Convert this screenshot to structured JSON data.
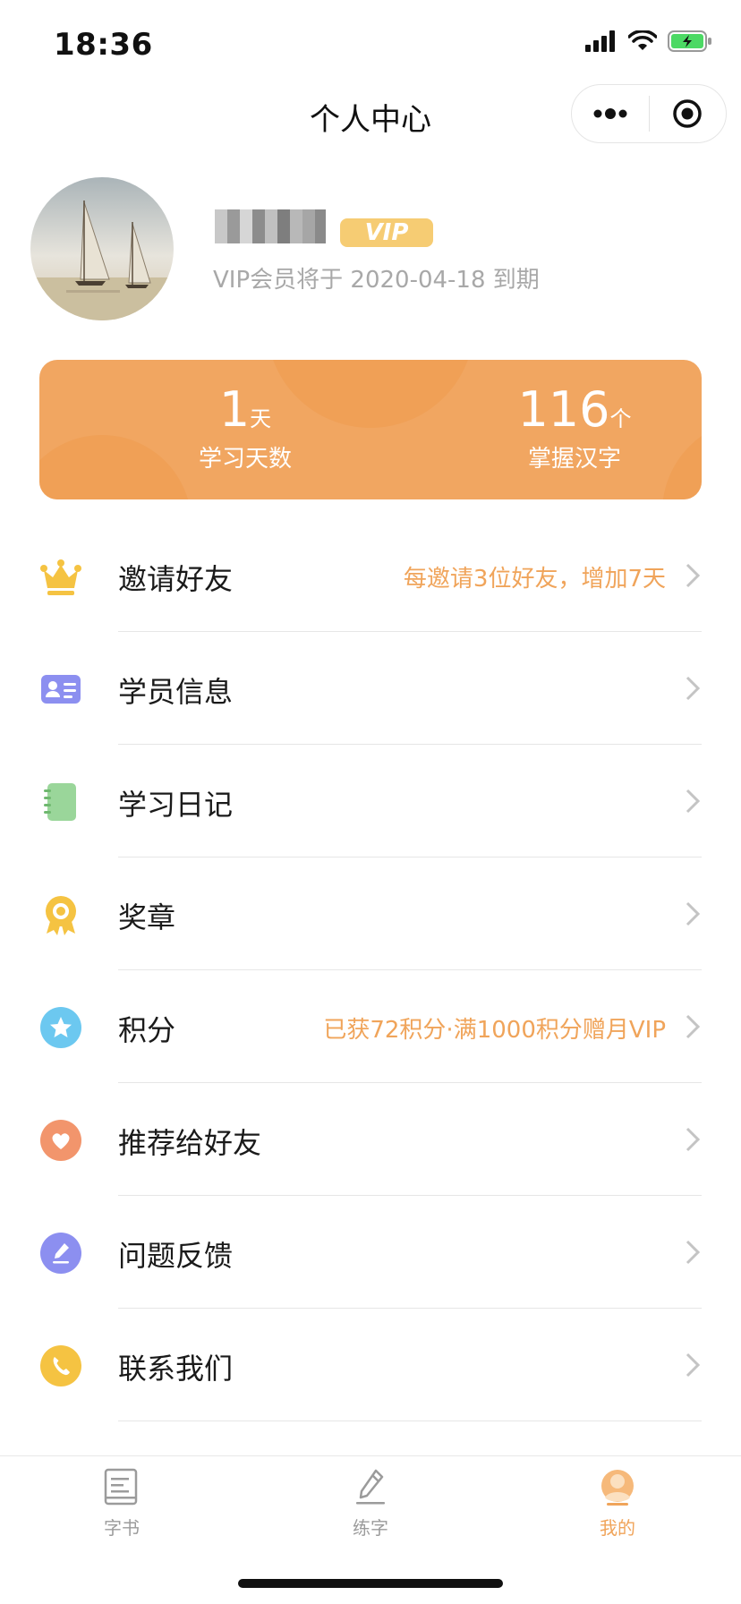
{
  "status_bar": {
    "time": "18:36"
  },
  "nav": {
    "title": "个人中心"
  },
  "profile": {
    "vip_badge": "VIP",
    "vip_expire": "VIP会员将于 2020-04-18 到期"
  },
  "stats": [
    {
      "value": "1",
      "unit": "天",
      "label": "学习天数"
    },
    {
      "value": "116",
      "unit": "个",
      "label": "掌握汉字"
    }
  ],
  "menu": [
    {
      "label": "邀请好友",
      "extra": "每邀请3位好友，增加7天",
      "icon": "crown-icon",
      "color": "#f5c342"
    },
    {
      "label": "学员信息",
      "extra": "",
      "icon": "id-card-icon",
      "color": "#8c8ff0"
    },
    {
      "label": "学习日记",
      "extra": "",
      "icon": "notebook-icon",
      "color": "#9ad69a"
    },
    {
      "label": "奖章",
      "extra": "",
      "icon": "medal-icon",
      "color": "#f5c342"
    },
    {
      "label": "积分",
      "extra": "已获72积分·满1000积分赠月VIP",
      "icon": "star-icon",
      "color": "#6cc8f0"
    },
    {
      "label": "推荐给好友",
      "extra": "",
      "icon": "heart-icon",
      "color": "#f2956c"
    },
    {
      "label": "问题反馈",
      "extra": "",
      "icon": "pencil-icon",
      "color": "#8c8ff0"
    },
    {
      "label": "联系我们",
      "extra": "",
      "icon": "phone-icon",
      "color": "#f5c342"
    }
  ],
  "tabs": [
    {
      "label": "字书",
      "icon": "book-icon",
      "active": false
    },
    {
      "label": "练字",
      "icon": "brush-icon",
      "active": false
    },
    {
      "label": "我的",
      "icon": "profile-icon",
      "active": true
    }
  ],
  "colors": {
    "accent": "#f0a45a",
    "stats_card": "#f1a661",
    "vip_badge": "#f6cc73"
  }
}
